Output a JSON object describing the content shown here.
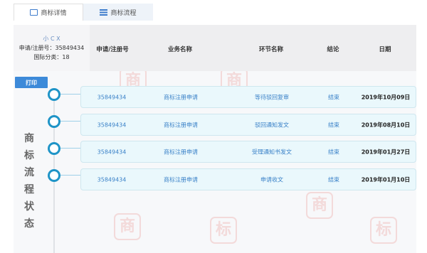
{
  "tabs": [
    {
      "label": "商标详情",
      "icon": "id-card-icon",
      "active": false
    },
    {
      "label": "商标流程",
      "icon": "list-icon",
      "active": true
    }
  ],
  "info": {
    "name": "小 C X",
    "reg_line": "申请/注册号：35849434",
    "class_line": "国际分类：18"
  },
  "columns": [
    "申请/注册号",
    "业务名称",
    "环节名称",
    "结论",
    "日期"
  ],
  "print_label": "打印",
  "vertical_title": [
    "商",
    "标",
    "流",
    "程",
    "状",
    "态"
  ],
  "rows": [
    {
      "reg_no": "35849434",
      "business": "商标注册申请",
      "step": "等待驳回复审",
      "result": "结束",
      "date": "2019年10月09日"
    },
    {
      "reg_no": "35849434",
      "business": "商标注册申请",
      "step": "驳回通知发文",
      "result": "结束",
      "date": "2019年08月10日"
    },
    {
      "reg_no": "35849434",
      "business": "商标注册申请",
      "step": "受理通知书发文",
      "result": "结束",
      "date": "2019年01月27日"
    },
    {
      "reg_no": "35849434",
      "business": "商标注册申请",
      "step": "申请收文",
      "result": "结束",
      "date": "2019年01月10日"
    }
  ],
  "watermark_glyphs": [
    "商",
    "标"
  ],
  "colors": {
    "accent": "#3d8ad9",
    "link": "#3b82c8",
    "timeline": "#1f94c7",
    "row_bg": "#eaf8fc"
  }
}
